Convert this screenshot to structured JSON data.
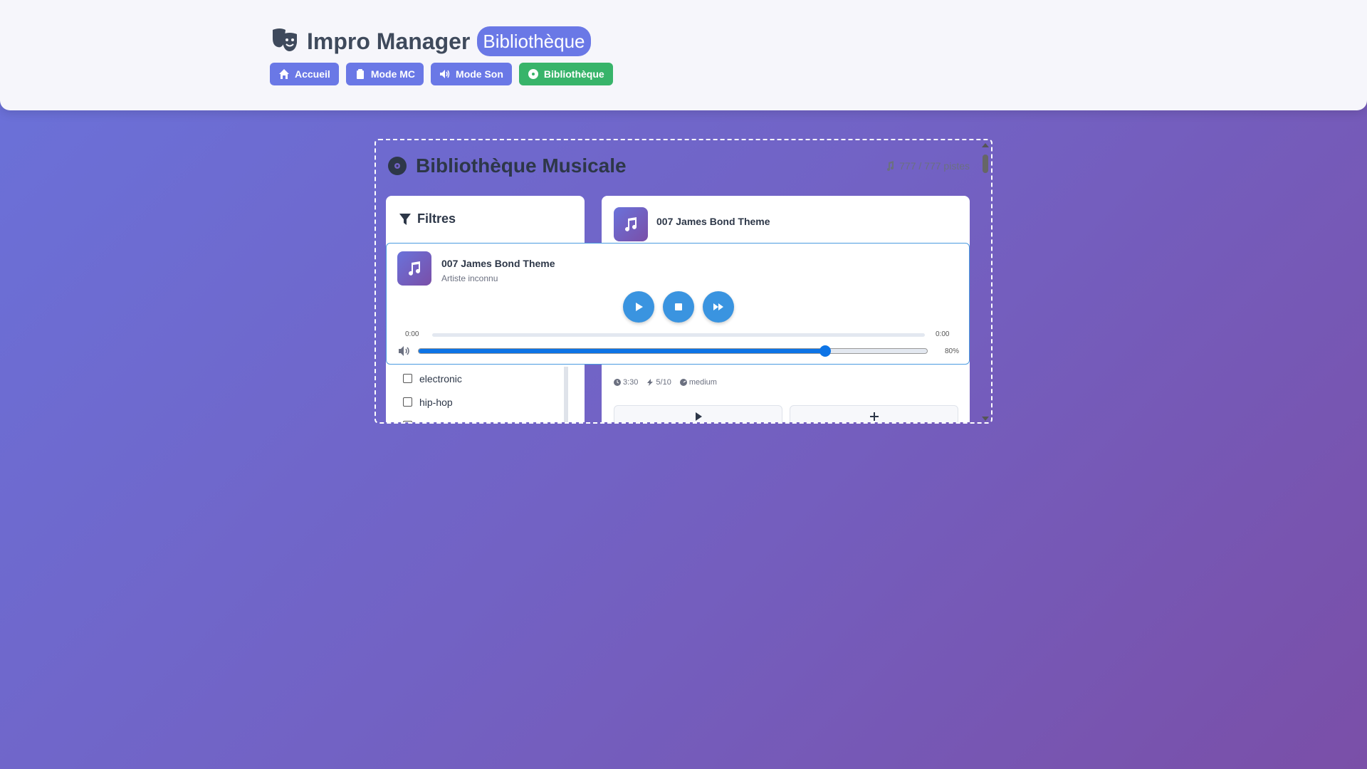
{
  "app": {
    "title": "Impro Manager",
    "badge": "Bibliothèque"
  },
  "nav": [
    {
      "label": "Accueil",
      "icon": "home-icon",
      "active": false
    },
    {
      "label": "Mode MC",
      "icon": "clipboard-icon",
      "active": false
    },
    {
      "label": "Mode Son",
      "icon": "speaker-icon",
      "active": false
    },
    {
      "label": "Bibliothèque",
      "icon": "disc-icon",
      "active": true
    }
  ],
  "library": {
    "title": "Bibliothèque Musicale",
    "count_label": "777 / 777 pistes",
    "filters": {
      "title": "Filtres",
      "options": [
        {
          "label": "electronic",
          "checked": false
        },
        {
          "label": "hip-hop",
          "checked": false
        }
      ]
    },
    "card": {
      "title": "007 James Bond Theme",
      "duration": "3:30",
      "energy": "5/10",
      "tempo": "medium"
    }
  },
  "player": {
    "title": "007 James Bond Theme",
    "artist": "Artiste inconnu",
    "time_current": "0:00",
    "time_total": "0:00",
    "progress": 0,
    "volume": 0.8,
    "volume_label": "80%"
  },
  "colors": {
    "accent": "#6a78e6",
    "active": "#38b46a",
    "player_blue": "#3a94e0",
    "volume_blue": "#0d74e6"
  }
}
